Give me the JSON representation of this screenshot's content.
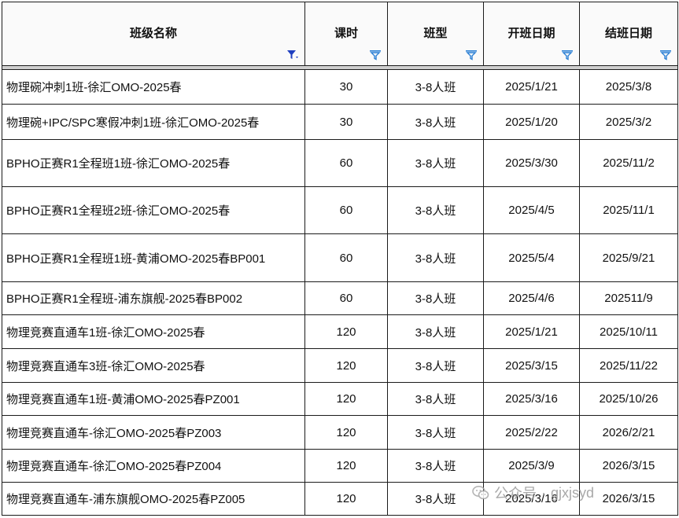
{
  "table": {
    "columns": [
      {
        "label": "班级名称",
        "filter": "funnel-active"
      },
      {
        "label": "课时",
        "filter": "funnel-lines"
      },
      {
        "label": "班型",
        "filter": "funnel-lines"
      },
      {
        "label": "开班日期",
        "filter": "funnel-lines"
      },
      {
        "label": "结班日期",
        "filter": "funnel-lines"
      }
    ],
    "rows": [
      [
        "物理碗冲刺1班-徐汇OMO-2025春",
        "30",
        "3-8人班",
        "2025/1/21",
        "2025/3/8"
      ],
      [
        "物理碗+IPC/SPC寒假冲刺1班-徐汇OMO-2025春",
        "30",
        "3-8人班",
        "2025/1/20",
        "2025/3/2"
      ],
      [
        "BPHO正赛R1全程班1班-徐汇OMO-2025春",
        "60",
        "3-8人班",
        "2025/3/30",
        "2025/11/2"
      ],
      [
        "BPHO正赛R1全程班2班-徐汇OMO-2025春",
        "60",
        "3-8人班",
        "2025/4/5",
        "2025/11/1"
      ],
      [
        "BPHO正赛R1全程班1班-黄浦OMO-2025春BP001",
        "60",
        "3-8人班",
        "2025/5/4",
        "2025/9/21"
      ],
      [
        "BPHO正赛R1全程班-浦东旗舰-2025春BP002",
        "60",
        "3-8人班",
        "2025/4/6",
        "202511/9"
      ],
      [
        "物理竞赛直通车1班-徐汇OMO-2025春",
        "120",
        "3-8人班",
        "2025/1/21",
        "2025/10/11"
      ],
      [
        "物理竞赛直通车3班-徐汇OMO-2025春",
        "120",
        "3-8人班",
        "2025/3/15",
        "2025/11/22"
      ],
      [
        "物理竞赛直通车1班-黄浦OMO-2025春PZ001",
        "120",
        "3-8人班",
        "2025/3/16",
        "2025/10/26"
      ],
      [
        "物理竞赛直通车-徐汇OMO-2025春PZ003",
        "120",
        "3-8人班",
        "2025/2/22",
        "2026/2/21"
      ],
      [
        "物理竞赛直通车-徐汇OMO-2025春PZ004",
        "120",
        "3-8人班",
        "2025/3/9",
        "2026/3/15"
      ],
      [
        "物理竞赛直通车-浦东旗舰OMO-2025春PZ005",
        "120",
        "3-8人班",
        "2025/3/16",
        "2026/3/15"
      ]
    ]
  },
  "watermark": {
    "icon": "wechat-logo-icon",
    "text": "公众号",
    "separator": "·",
    "account": "gjxjsyd"
  },
  "colors": {
    "filter_active": "#1f3fbf",
    "filter_icon": "#2a7fd4",
    "separator_bar": "#cfcfcf"
  }
}
